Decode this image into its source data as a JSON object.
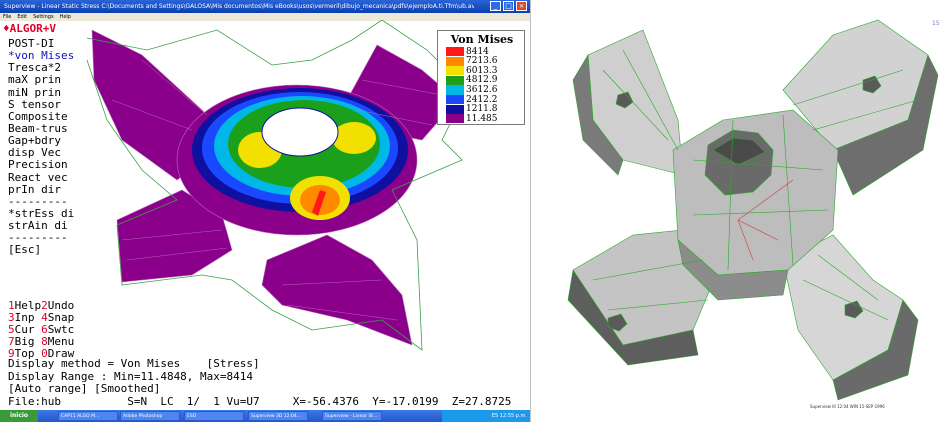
{
  "window": {
    "title": "Superview - Linear Static Stress   C:\\Documents and Settings\\GALOSA\\Mis documentos\\Mis eBooks\\usos\\vermeril\\dibujo_mecanica\\pdfs\\ejemploA.ti.Tfm\\ub.avd",
    "menu": [
      "File",
      "Edit",
      "Settings",
      "Help"
    ]
  },
  "brand": "ALGOR+V",
  "command_menu": [
    {
      "text": "POST-DI",
      "hl": false
    },
    {
      "text": "*von Mises",
      "hl": true
    },
    {
      "text": "Tresca*2",
      "hl": false
    },
    {
      "text": "maX prin",
      "hl": false
    },
    {
      "text": "miN prin",
      "hl": false
    },
    {
      "text": "S tensor",
      "hl": false
    },
    {
      "text": "Composite",
      "hl": false
    },
    {
      "text": "Beam-trus",
      "hl": false
    },
    {
      "text": "Gap+bdry",
      "hl": false
    },
    {
      "text": "disp Vec",
      "hl": false
    },
    {
      "text": "Precision",
      "hl": false
    },
    {
      "text": "React vec",
      "hl": false
    },
    {
      "text": "prIn dir",
      "hl": false
    },
    {
      "text": "---------",
      "hl": false
    },
    {
      "text": "*strEss di",
      "hl": false
    },
    {
      "text": "strAin di",
      "hl": false
    },
    {
      "text": "---------",
      "hl": false
    },
    {
      "text": "[Esc]",
      "hl": false
    }
  ],
  "function_keys": [
    [
      {
        "k": "1",
        "l": "Help"
      },
      {
        "k": "2",
        "l": "Undo"
      }
    ],
    [
      {
        "k": "3",
        "l": "Inp "
      },
      {
        "k": "4",
        "l": "Snap"
      }
    ],
    [
      {
        "k": "5",
        "l": "Cur "
      },
      {
        "k": "6",
        "l": "Swtc"
      }
    ],
    [
      {
        "k": "7",
        "l": "Big "
      },
      {
        "k": "8",
        "l": "Menu"
      }
    ],
    [
      {
        "k": "9",
        "l": "Top "
      },
      {
        "k": "0",
        "l": "Draw"
      }
    ]
  ],
  "legend": {
    "title": "Von Mises",
    "entries": [
      {
        "value": "8414",
        "color": "#ff1a1a"
      },
      {
        "value": "7213.6",
        "color": "#ff8a00"
      },
      {
        "value": "6013.3",
        "color": "#f2e000"
      },
      {
        "value": "4812.9",
        "color": "#1aa01a"
      },
      {
        "value": "3612.6",
        "color": "#00b8e8"
      },
      {
        "value": "2412.2",
        "color": "#1a48ff"
      },
      {
        "value": "1211.8",
        "color": "#1010a0"
      },
      {
        "value": "11.485",
        "color": "#8a008a"
      }
    ]
  },
  "status_lines": [
    "Display method = Von Mises    [Stress]",
    "Display Range : Min=11.4848, Max=8414",
    "[Auto range] [Smoothed]",
    "File:hub          S=N  LC  1/  1 Vu=U7     X=-56.4376  Y=-17.0199  Z=27.8725"
  ],
  "taskbar": {
    "start": "inicio",
    "tasks": [
      "CAP11 ALGO M...",
      "Adobe Photoshop",
      "ESO",
      "Superview 3D 12:04...",
      "Superview - Linear St..."
    ],
    "clock": "ES   12:55 p.m."
  },
  "right_panel": {
    "corner_text": "15",
    "caption": "Superview III 12:04 WIN 15-SEP-1996"
  },
  "colors": {
    "title_bar": "#0a3fb0",
    "model_base": "#8a008a",
    "part_gray": "#c8c8c8",
    "mesh_green": "#2aaa2a"
  }
}
